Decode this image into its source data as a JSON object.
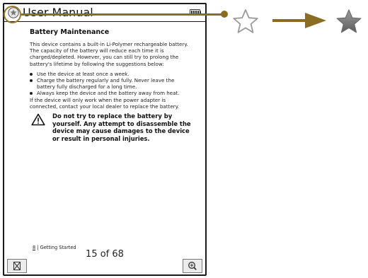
{
  "titlebar": {
    "title": "User Manual",
    "favorite_icon": "star-icon",
    "battery_icon": "battery-icon"
  },
  "content": {
    "heading": "Battery Maintenance",
    "intro": "This device contains a built-in Li-Polymer rechargeable battery. The capacity of the battery will reduce each time it is charged/depleted. However, you can still try to prolong the battery's lifetime by following the suggestions below:",
    "bullets": [
      "Use the device at least once a week.",
      "Charge the battery regularly and fully. Never leave the battery fully discharged for a long time.",
      "Always keep the device and the battery away from heat."
    ],
    "adapter_note": "If the device will only work when the power adapter is connected, contact your local dealer to replace the battery.",
    "warning": "Do not try to replace the battery by yourself. Any attempt to disassemble the device may cause damages to the device or result in personal injuries."
  },
  "footer": {
    "page_number": "8",
    "section": "| Getting Started"
  },
  "navigation": {
    "page_indicator": "15 of 68",
    "close_icon": "close-icon",
    "zoom_icon": "zoom-in-icon"
  },
  "annotation": {
    "from_icon": "star-outline-icon",
    "to_icon": "star-filled-icon",
    "accent_color": "#8a6d22"
  }
}
